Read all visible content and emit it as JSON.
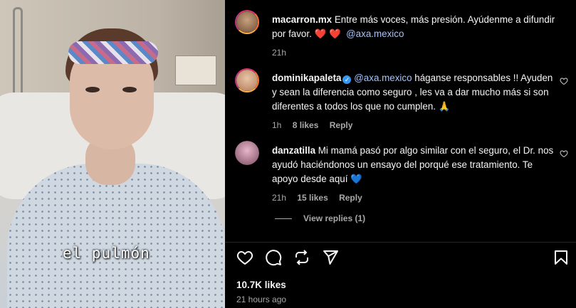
{
  "video": {
    "caption": "el pulmón"
  },
  "comments": [
    {
      "username": "macarron.mx",
      "text_before": "Entre más voces, más presión. Ayúdenme a difundir por favor. ",
      "hearts": "❤️ ❤️",
      "mention": "@axa.mexico",
      "time": "21h",
      "likes": "",
      "reply": ""
    },
    {
      "username": "dominikapaleta",
      "verified": true,
      "mention": "@axa.mexico",
      "text_after": " háganse responsables !! Ayuden y sean la diferencia como seguro , les va a dar mucho más si son diferentes a todos los que no cumplen. 🙏",
      "time": "1h",
      "likes": "8 likes",
      "reply": "Reply"
    },
    {
      "username": "danzatilla",
      "text": "Mi mamá pasó por algo similar con el seguro, el Dr. nos ayudó haciéndonos un ensayo del porqué ese tratamiento. Te apoyo desde aquí 💙",
      "time": "21h",
      "likes": "15 likes",
      "reply": "Reply"
    }
  ],
  "view_replies": "View replies (1)",
  "post": {
    "likes": "10.7K likes",
    "posted": "21 hours ago"
  },
  "icons": [
    "heart-icon",
    "comment-icon",
    "share-icon",
    "send-icon",
    "bookmark-icon"
  ]
}
